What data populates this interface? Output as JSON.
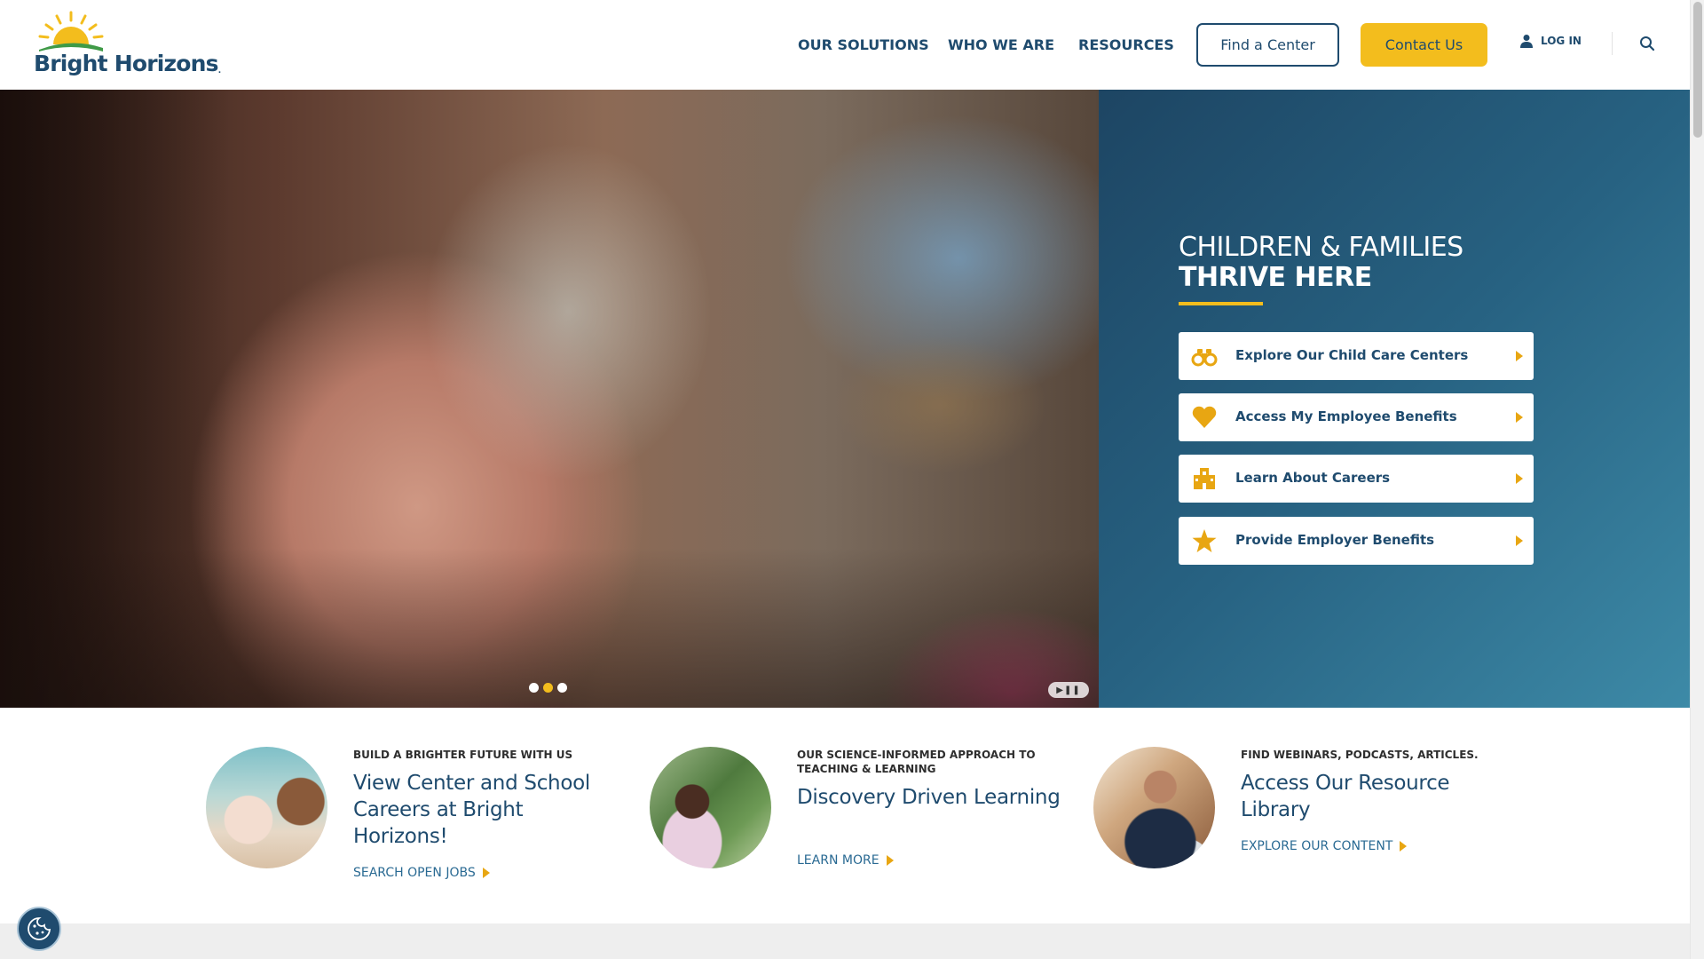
{
  "brand": {
    "name": "Bright Horizons",
    "tm": ".",
    "colors": {
      "navy": "#1f4b6e",
      "gold": "#f3bd1d",
      "teal": "#276282"
    }
  },
  "nav": {
    "items": [
      {
        "label": "OUR SOLUTIONS"
      },
      {
        "label": "WHO WE ARE"
      },
      {
        "label": "RESOURCES"
      }
    ],
    "find_center": "Find a Center",
    "contact": "Contact Us",
    "login": "LOG IN",
    "icons": {
      "user": "user-icon",
      "search": "search-icon"
    }
  },
  "hero": {
    "title_line1": "CHILDREN & FAMILIES",
    "title_line2": "THRIVE HERE",
    "slides": 3,
    "active_slide": 2,
    "ctas": [
      {
        "label": "Explore Our Child Care Centers",
        "icon": "binoculars-icon"
      },
      {
        "label": "Access My Employee Benefits",
        "icon": "heart-icon"
      },
      {
        "label": "Learn About Careers",
        "icon": "building-icon"
      },
      {
        "label": "Provide Employer Benefits",
        "icon": "star-icon"
      }
    ]
  },
  "promos": [
    {
      "eyebrow": "BUILD A BRIGHTER FUTURE WITH US",
      "headline": "View Center and School Careers at Bright Horizons!",
      "link": "SEARCH OPEN JOBS"
    },
    {
      "eyebrow": "OUR SCIENCE-INFORMED APPROACH TO TEACHING & LEARNING",
      "headline": "Discovery Driven Learning",
      "link": "LEARN MORE"
    },
    {
      "eyebrow": "FIND WEBINARS, PODCASTS, ARTICLES.",
      "headline": "Access Our Resource Library",
      "link": "EXPLORE OUR CONTENT"
    }
  ]
}
